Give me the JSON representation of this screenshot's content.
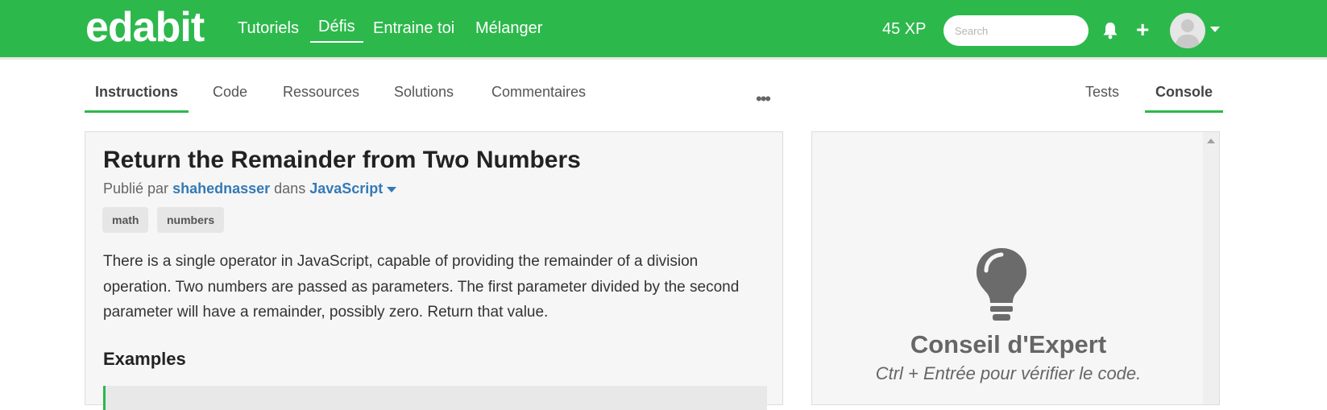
{
  "navbar": {
    "logo": "edabit",
    "links": [
      "Tutoriels",
      "Défis",
      "Entraine toi",
      "Mélanger"
    ],
    "active_link": "Défis",
    "xp": "45 XP",
    "search_placeholder": "Search",
    "accent_color": "#2db84c"
  },
  "tabs": {
    "left": [
      "Instructions",
      "Code",
      "Ressources",
      "Solutions",
      "Commentaires"
    ],
    "more": "•••",
    "right": [
      "Tests",
      "Console"
    ],
    "active_left": "Instructions",
    "active_right": "Console"
  },
  "challenge": {
    "title": "Return the Remainder from Two Numbers",
    "published_prefix": "Publié par",
    "author": "shahednasser",
    "in_word": "dans",
    "language": "JavaScript",
    "tags": [
      "math",
      "numbers"
    ],
    "description": "There is a single operator in JavaScript, capable of providing the remainder of a division operation. Two numbers are passed as parameters. The first parameter divided by the second parameter will have a remainder, possibly zero. Return that value.",
    "examples_heading": "Examples"
  },
  "console_panel": {
    "icon": "lightbulb-icon",
    "tip_title": "Conseil d'Expert",
    "tip_text": "Ctrl + Entrée pour vérifier le code."
  }
}
